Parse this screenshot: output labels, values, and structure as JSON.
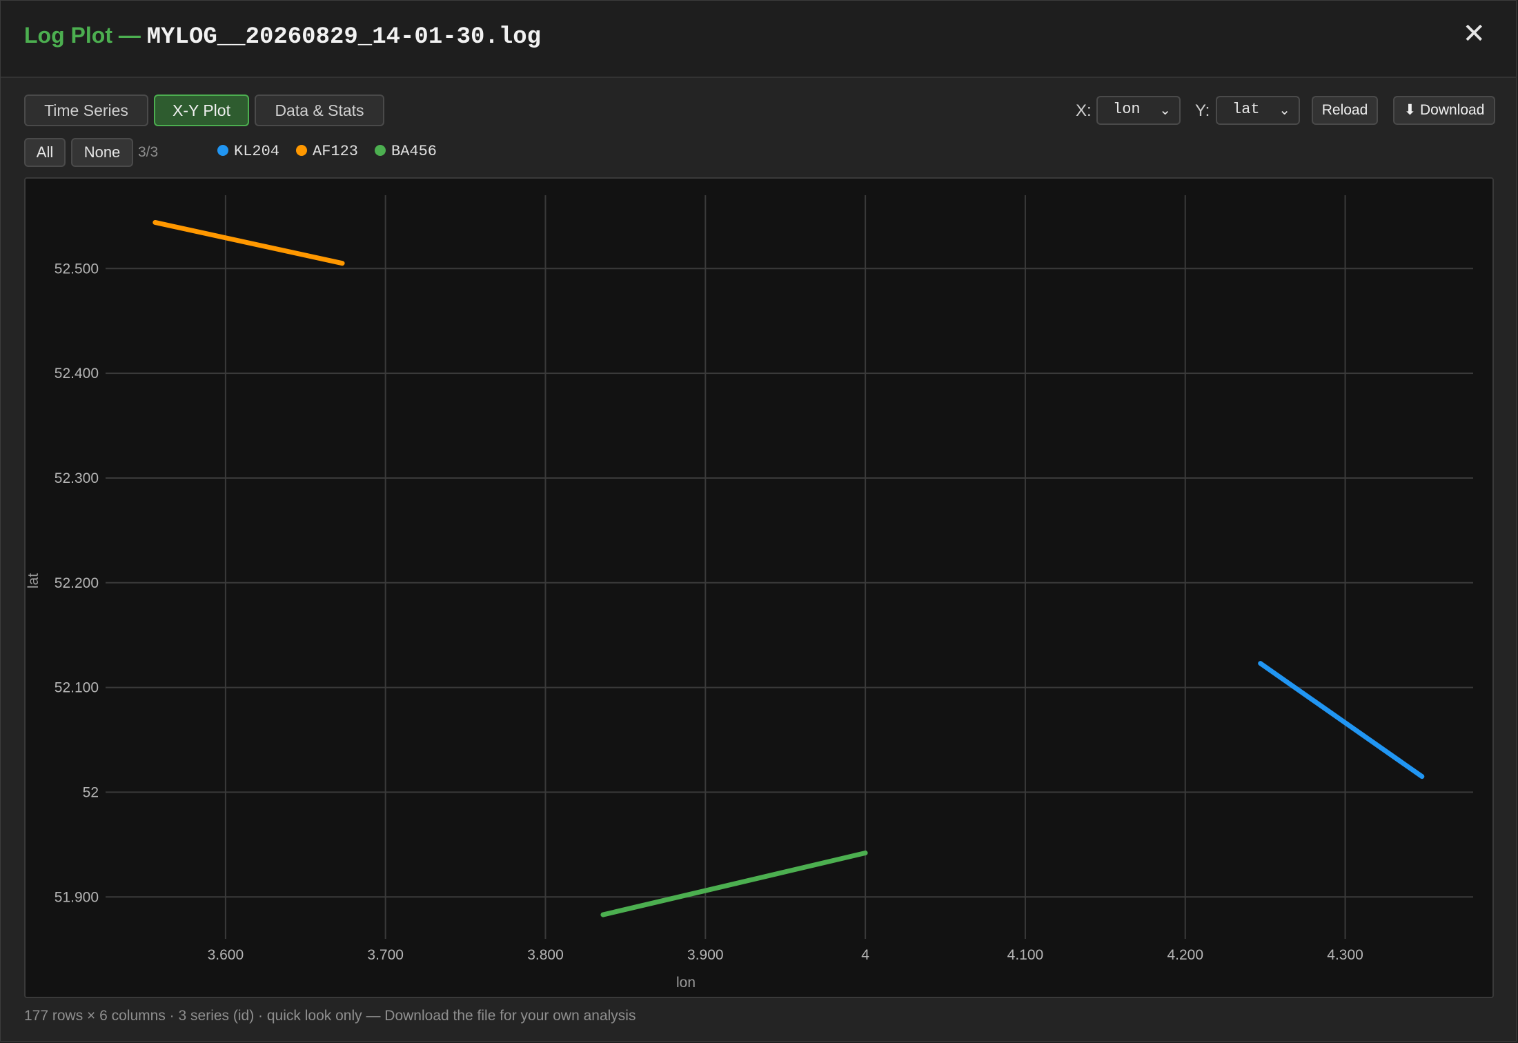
{
  "header": {
    "title_prefix": "Log Plot —",
    "filename": "MYLOG__20260829_14-01-30.log",
    "close_label": "✕"
  },
  "tabs": [
    {
      "label": "Time Series",
      "active": false
    },
    {
      "label": "X-Y Plot",
      "active": true
    },
    {
      "label": "Data & Stats",
      "active": false
    }
  ],
  "controls": {
    "x_label": "X:",
    "x_value": "lon",
    "y_label": "Y:",
    "y_value": "lat",
    "reload_label": "Reload",
    "download_label": "⬇ Download"
  },
  "series_filter": {
    "all_label": "All",
    "none_label": "None",
    "count": "3/3"
  },
  "legend": [
    {
      "name": "KL204",
      "color": "#2196f3"
    },
    {
      "name": "AF123",
      "color": "#ff9800"
    },
    {
      "name": "BA456",
      "color": "#4caf50"
    }
  ],
  "footer": "177 rows × 6 columns · 3 series (id) · quick look only — Download the file for your own analysis",
  "chart_data": {
    "type": "line",
    "xlabel": "lon",
    "ylabel": "lat",
    "xlim": [
      3.525,
      4.38
    ],
    "ylim": [
      51.86,
      52.57
    ],
    "grid": true,
    "x_ticks": [
      {
        "v": 3.6,
        "label": "3.600"
      },
      {
        "v": 3.7,
        "label": "3.700"
      },
      {
        "v": 3.8,
        "label": "3.800"
      },
      {
        "v": 3.9,
        "label": "3.900"
      },
      {
        "v": 4.0,
        "label": "4"
      },
      {
        "v": 4.1,
        "label": "4.100"
      },
      {
        "v": 4.2,
        "label": "4.200"
      },
      {
        "v": 4.3,
        "label": "4.300"
      }
    ],
    "y_ticks": [
      {
        "v": 51.9,
        "label": "51.900"
      },
      {
        "v": 52.0,
        "label": "52"
      },
      {
        "v": 52.1,
        "label": "52.100"
      },
      {
        "v": 52.2,
        "label": "52.200"
      },
      {
        "v": 52.3,
        "label": "52.300"
      },
      {
        "v": 52.4,
        "label": "52.400"
      },
      {
        "v": 52.5,
        "label": "52.500"
      }
    ],
    "series": [
      {
        "name": "KL204",
        "color": "#2196f3",
        "x": [
          4.247,
          4.348
        ],
        "y": [
          52.123,
          52.015
        ]
      },
      {
        "name": "AF123",
        "color": "#ff9800",
        "x": [
          3.556,
          3.673
        ],
        "y": [
          52.544,
          52.505
        ]
      },
      {
        "name": "BA456",
        "color": "#4caf50",
        "x": [
          3.836,
          4.0
        ],
        "y": [
          51.883,
          51.942
        ]
      }
    ]
  }
}
